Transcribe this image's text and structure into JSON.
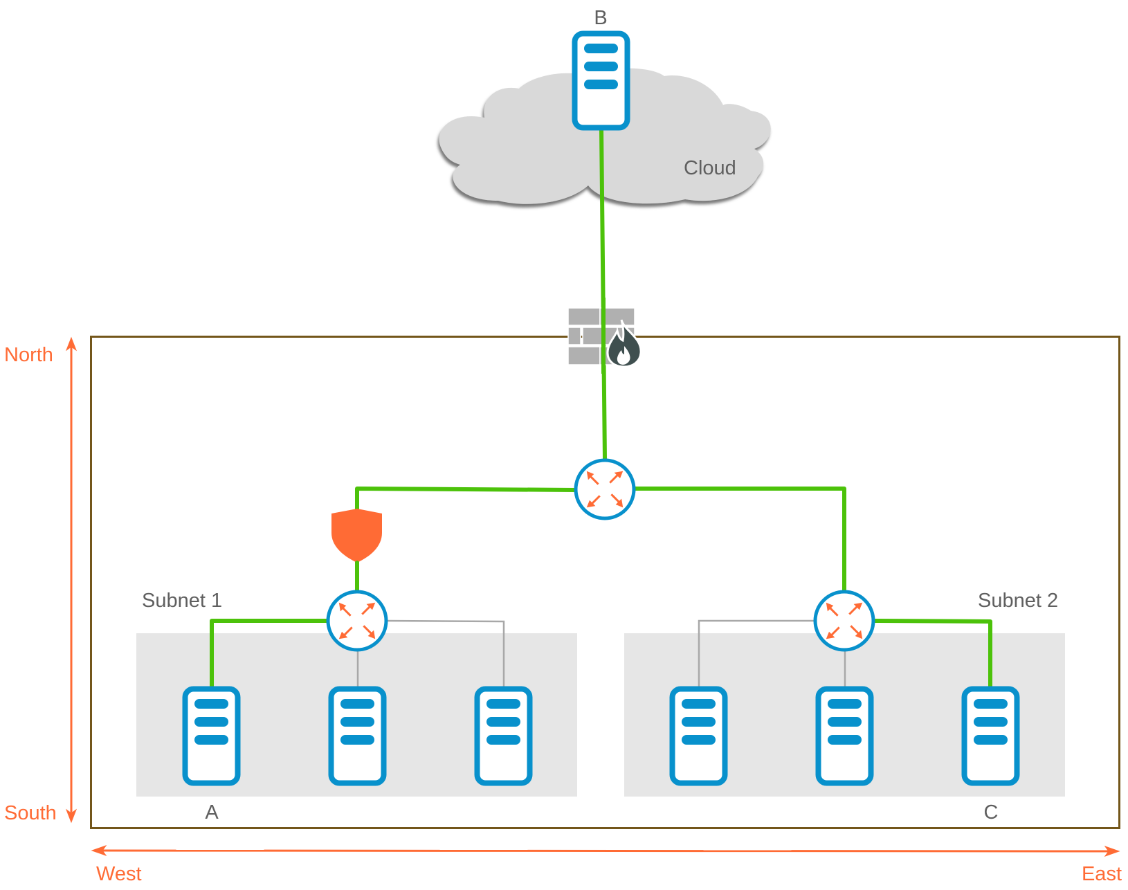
{
  "colors": {
    "secure_link": "#4cc20a",
    "plain_link": "#a8a8a8",
    "server_blue": "#0891cc",
    "router_arrow": "#ff6b35",
    "shield": "#ff6b35",
    "boundary": "#73561a",
    "subnet_fill": "#e6e6e6",
    "cloud_fill": "#d9d9d9",
    "direction": "#ff6b35",
    "firewall_brick": "#b0b0b0",
    "flame": "#3f4f4f"
  },
  "cloud": {
    "label": "Cloud",
    "icon": "cloud-icon"
  },
  "nodes": {
    "server_b": {
      "label": "B",
      "icon": "server-icon"
    },
    "server_a": {
      "label": "A",
      "icon": "server-icon"
    },
    "server_c": {
      "label": "C",
      "icon": "server-icon"
    },
    "firewall": {
      "icon": "firewall-icon"
    },
    "waf_shield": {
      "icon": "shield-icon"
    },
    "core_router": {
      "icon": "router-icon"
    },
    "subnet1_router": {
      "icon": "router-icon"
    },
    "subnet2_router": {
      "icon": "router-icon"
    }
  },
  "subnets": [
    {
      "label": "Subnet 1",
      "servers": [
        "A",
        "",
        ""
      ]
    },
    {
      "label": "Subnet 2",
      "servers": [
        "",
        "",
        "C"
      ]
    }
  ],
  "links": [
    {
      "from": "B",
      "to": "core-router",
      "secure": true,
      "via": "firewall"
    },
    {
      "from": "core-router",
      "to": "subnet1-router",
      "secure": true,
      "via": "shield"
    },
    {
      "from": "core-router",
      "to": "subnet2-router",
      "secure": true
    },
    {
      "from": "subnet1-router",
      "to": "A",
      "secure": true
    },
    {
      "from": "subnet1-router",
      "to": "subnet1-server-2",
      "secure": false
    },
    {
      "from": "subnet1-router",
      "to": "subnet1-server-3",
      "secure": false
    },
    {
      "from": "subnet2-router",
      "to": "subnet2-server-1",
      "secure": false
    },
    {
      "from": "subnet2-router",
      "to": "subnet2-server-2",
      "secure": false
    },
    {
      "from": "subnet2-router",
      "to": "C",
      "secure": true
    }
  ],
  "directions": {
    "north": "North",
    "south": "South",
    "west": "West",
    "east": "East"
  }
}
